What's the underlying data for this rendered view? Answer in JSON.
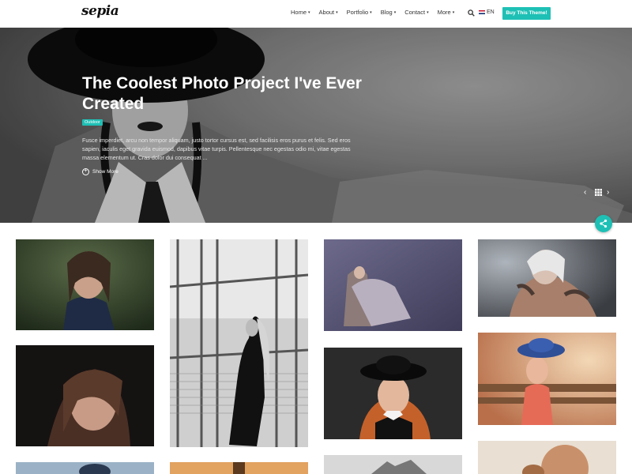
{
  "header": {
    "logo": "sepia",
    "nav": [
      {
        "label": "Home",
        "caret": "▾"
      },
      {
        "label": "About",
        "caret": "▾"
      },
      {
        "label": "Portfolio",
        "caret": "▾"
      },
      {
        "label": "Blog",
        "caret": "▾"
      },
      {
        "label": "Contact",
        "caret": "▾"
      },
      {
        "label": "More",
        "caret": "▾"
      }
    ],
    "search_icon": "search-icon",
    "lang": "EN",
    "buy_button": "Buy This Theme!"
  },
  "hero": {
    "title": "The Coolest Photo Project I've Ever Created",
    "tag": "Outdoor",
    "excerpt": "Fusce imperdiet, arcu non tempor aliquam, justo tortor cursus est, sed facilisis eros purus et felis. Sed eros sapien, iaculis eget gravida euismod, dapibus vitae turpis. Pellentesque nec egestas odio mi, vitae egestas massa elementum ut. Cras dolor dui consequat ...",
    "show_more": "Show More",
    "prev_icon": "‹",
    "next_icon": "›"
  },
  "gallery": {
    "columns": 4,
    "images": [
      {
        "name": "wet-hair-portrait",
        "tone": "#3b4a33"
      },
      {
        "name": "window-fence-bw",
        "tone": "#a9a9a9"
      },
      {
        "name": "chair-purple",
        "tone": "#5c5a79"
      },
      {
        "name": "tattoo-woman",
        "tone": "#6d6f73"
      },
      {
        "name": "dark-portrait",
        "tone": "#1f1a1a"
      },
      {
        "name": "red-hair-hat",
        "tone": "#2a2a2a"
      },
      {
        "name": "blue-hat-sunset",
        "tone": "#d79a72"
      }
    ]
  },
  "colors": {
    "accent": "#1ec0b5"
  }
}
